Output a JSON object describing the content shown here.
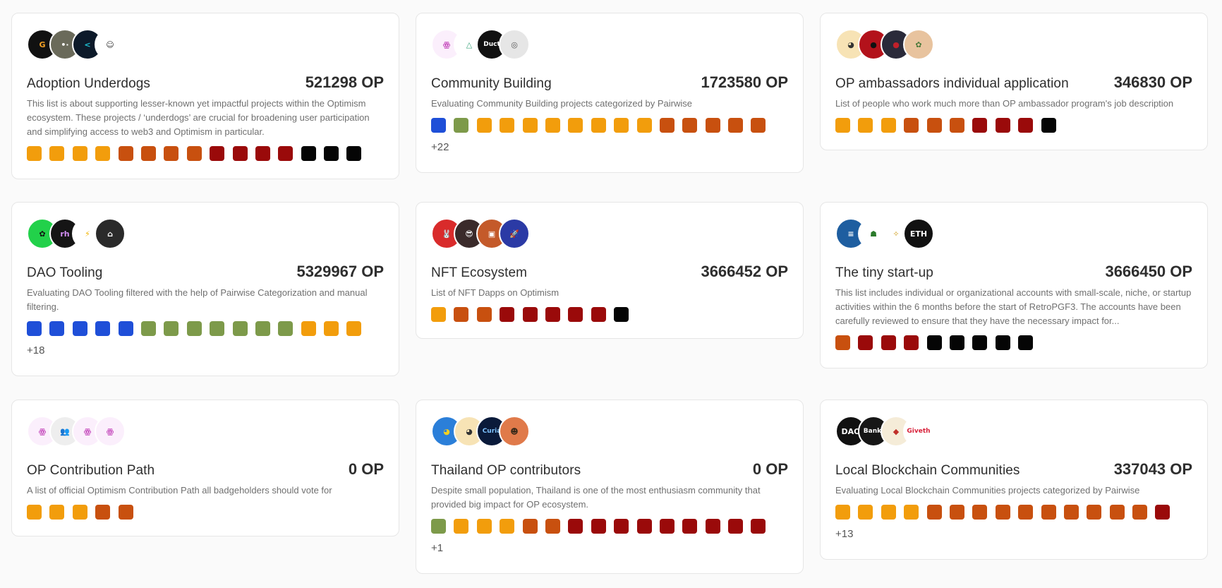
{
  "colors": {
    "yellow": "#f29d0c",
    "orange": "#c8500f",
    "red": "#9a0a0a",
    "black": "#050505",
    "blue": "#1f4fd8",
    "green": "#7d9a4a"
  },
  "cards": [
    {
      "title": "Adoption Underdogs",
      "amount": "521298 OP",
      "description": "This list is about supporting lesser-known yet impactful projects within the Optimism ecosystem. These projects / ‘underdogs’ are crucial for broadening user participation and simplifying access to web3 and Optimism in particular.",
      "avatars": [
        {
          "icon": "gitcoin-logo-icon",
          "text": "G",
          "bg": "#111111",
          "fg": "#f2a024"
        },
        {
          "icon": "panda-avatar-icon",
          "text": "•·",
          "bg": "#6a6a5a",
          "fg": "#ffffff"
        },
        {
          "icon": "chevron-logo-icon",
          "text": "<",
          "bg": "#0d1a2a",
          "fg": "#1ec3d6"
        },
        {
          "icon": "face-sketch-icon",
          "text": "☺",
          "bg": "#ffffff",
          "fg": "#333333"
        }
      ],
      "swatches": [
        "yellow",
        "yellow",
        "yellow",
        "yellow",
        "orange",
        "orange",
        "orange",
        "orange",
        "red",
        "red",
        "red",
        "red",
        "black",
        "black",
        "black"
      ],
      "more": ""
    },
    {
      "title": "Community Building",
      "amount": "1723580 OP",
      "description": "Evaluating Community Building projects categorized by Pairwise",
      "avatars": [
        {
          "icon": "pairwise-list-icon",
          "text": "ꙮ",
          "bg": "#fbeffc",
          "fg": "#c13fb8"
        },
        {
          "icon": "triangle-logo-icon",
          "text": "△",
          "bg": "#ffffff",
          "fg": "#3aa37a"
        },
        {
          "icon": "duct-tape-logo-icon",
          "text": "Duct",
          "bg": "#111111",
          "fg": "#ffffff"
        },
        {
          "icon": "seal-logo-icon",
          "text": "◎",
          "bg": "#e6e6e6",
          "fg": "#555555"
        }
      ],
      "swatches": [
        "blue",
        "green",
        "yellow",
        "yellow",
        "yellow",
        "yellow",
        "yellow",
        "yellow",
        "yellow",
        "yellow",
        "orange",
        "orange",
        "orange",
        "orange",
        "orange"
      ],
      "more": "+22"
    },
    {
      "title": "OP ambassadors individual application",
      "amount": "346830 OP",
      "description": "List of people who work much more than OP ambassador program's job description",
      "avatars": [
        {
          "icon": "cowboy-duck-icon",
          "text": "◕",
          "bg": "#f7e3b5",
          "fg": "#333333"
        },
        {
          "icon": "red-portrait-icon",
          "text": "●",
          "bg": "#b3121b",
          "fg": "#111111"
        },
        {
          "icon": "dark-portrait-icon",
          "text": "●",
          "bg": "#2a2a3a",
          "fg": "#c0202a"
        },
        {
          "icon": "leaf-logo-icon",
          "text": "✿",
          "bg": "#e8c39e",
          "fg": "#4a7a3a"
        }
      ],
      "swatches": [
        "yellow",
        "yellow",
        "yellow",
        "orange",
        "orange",
        "orange",
        "red",
        "red",
        "red",
        "black"
      ],
      "more": ""
    },
    {
      "title": "DAO Tooling",
      "amount": "5329967 OP",
      "description": "Evaluating DAO Tooling filtered with the help of Pairwise Categorization and manual filtering.",
      "avatars": [
        {
          "icon": "flower-logo-icon",
          "text": "✿",
          "bg": "#22d14a",
          "fg": "#111111"
        },
        {
          "icon": "rainbow-logo-icon",
          "text": "rh",
          "bg": "#151515",
          "fg": "#d38ef5"
        },
        {
          "icon": "lightning-icon",
          "text": "⚡",
          "bg": "#ffffff",
          "fg": "#f2b400"
        },
        {
          "icon": "temple-logo-icon",
          "text": "⌂",
          "bg": "#2a2a2a",
          "fg": "#ffffff"
        }
      ],
      "swatches": [
        "blue",
        "blue",
        "blue",
        "blue",
        "blue",
        "green",
        "green",
        "green",
        "green",
        "green",
        "green",
        "green",
        "yellow",
        "yellow",
        "yellow"
      ],
      "more": "+18"
    },
    {
      "title": "NFT Ecosystem",
      "amount": "3666452 OP",
      "description": "List of NFT Dapps on Optimism",
      "avatars": [
        {
          "icon": "bunny-avatar-icon",
          "text": "🐰",
          "bg": "#d92b2b",
          "fg": "#ffffff"
        },
        {
          "icon": "sunglasses-avatar-icon",
          "text": "😎",
          "bg": "#3a2a2a",
          "fg": "#ffffff"
        },
        {
          "icon": "toast-avatar-icon",
          "text": "▣",
          "bg": "#c45a2a",
          "fg": "#ffffff"
        },
        {
          "icon": "rocket-logo-icon",
          "text": "🚀",
          "bg": "#2b3aa5",
          "fg": "#ffffff"
        }
      ],
      "swatches": [
        "yellow",
        "orange",
        "orange",
        "red",
        "red",
        "red",
        "red",
        "red",
        "black"
      ],
      "more": ""
    },
    {
      "title": "The tiny start-up",
      "amount": "3666450 OP",
      "description": "This list includes individual or organizational accounts with small-scale, niche, or startup activities within the 6 months before the start of RetroPGF3. The accounts have been carefully reviewed to ensure that they have the necessary impact for...",
      "avatars": [
        {
          "icon": "blue-logo-icon",
          "text": "≡",
          "bg": "#1e5ea0",
          "fg": "#ffffff"
        },
        {
          "icon": "monster-avatar-icon",
          "text": "☗",
          "bg": "#ffffff",
          "fg": "#2a7a2a"
        },
        {
          "icon": "bunny-character-icon",
          "text": "✧",
          "bg": "#ffffff",
          "fg": "#d0a020"
        },
        {
          "icon": "eth-co-logo-icon",
          "text": "ETH",
          "bg": "#111111",
          "fg": "#ffffff"
        }
      ],
      "swatches": [
        "orange",
        "red",
        "red",
        "red",
        "black",
        "black",
        "black",
        "black",
        "black"
      ],
      "more": ""
    },
    {
      "title": "OP Contribution Path",
      "amount": "0 OP",
      "description": "A list of official Optimism Contribution Path all badgeholders should vote for",
      "avatars": [
        {
          "icon": "pairwise-list-icon",
          "text": "ꙮ",
          "bg": "#fbeffc",
          "fg": "#c13fb8"
        },
        {
          "icon": "people-group-icon",
          "text": "👥",
          "bg": "#eeeeee",
          "fg": "#555555"
        },
        {
          "icon": "pairwise-list-icon",
          "text": "ꙮ",
          "bg": "#fbeffc",
          "fg": "#c13fb8"
        },
        {
          "icon": "pairwise-list-icon",
          "text": "ꙮ",
          "bg": "#fbeffc",
          "fg": "#c13fb8"
        }
      ],
      "swatches": [
        "yellow",
        "yellow",
        "yellow",
        "orange",
        "orange"
      ],
      "more": ""
    },
    {
      "title": "Thailand OP contributors",
      "amount": "0 OP",
      "description": "Despite small population, Thailand is one of the most enthusiasm community that provided big impact for OP ecosystem.",
      "avatars": [
        {
          "icon": "duck-character-icon",
          "text": "◕",
          "bg": "#2b7fd9",
          "fg": "#f2d022"
        },
        {
          "icon": "cowboy-duck-icon",
          "text": "◕",
          "bg": "#f7e3b5",
          "fg": "#333333"
        },
        {
          "icon": "curia-logo-icon",
          "text": "Curia",
          "bg": "#0a1a3a",
          "fg": "#7fc3ff"
        },
        {
          "icon": "bearded-man-icon",
          "text": "☻",
          "bg": "#e07a4a",
          "fg": "#3a2a1a"
        }
      ],
      "swatches": [
        "green",
        "yellow",
        "yellow",
        "yellow",
        "orange",
        "orange",
        "red",
        "red",
        "red",
        "red",
        "red",
        "red",
        "red",
        "red",
        "red"
      ],
      "more": "+1"
    },
    {
      "title": "Local Blockchain Communities",
      "amount": "337043 OP",
      "description": "Evaluating Local Blockchain Communities projects categorized by Pairwise",
      "avatars": [
        {
          "icon": "dao-turkiye-logo-icon",
          "text": "DAO",
          "bg": "#111111",
          "fg": "#ffffff"
        },
        {
          "icon": "bankless-logo-icon",
          "text": "Bankl",
          "bg": "#161616",
          "fg": "#ffffff"
        },
        {
          "icon": "ghana-eth-logo-icon",
          "text": "◆",
          "bg": "#f5ecd8",
          "fg": "#c0302a"
        },
        {
          "icon": "giveth-house-logo-icon",
          "text": "Giveth",
          "bg": "#ffffff",
          "fg": "#d8213a"
        }
      ],
      "swatches": [
        "yellow",
        "yellow",
        "yellow",
        "yellow",
        "orange",
        "orange",
        "orange",
        "orange",
        "orange",
        "orange",
        "orange",
        "orange",
        "orange",
        "orange",
        "red"
      ],
      "more": "+13"
    }
  ]
}
